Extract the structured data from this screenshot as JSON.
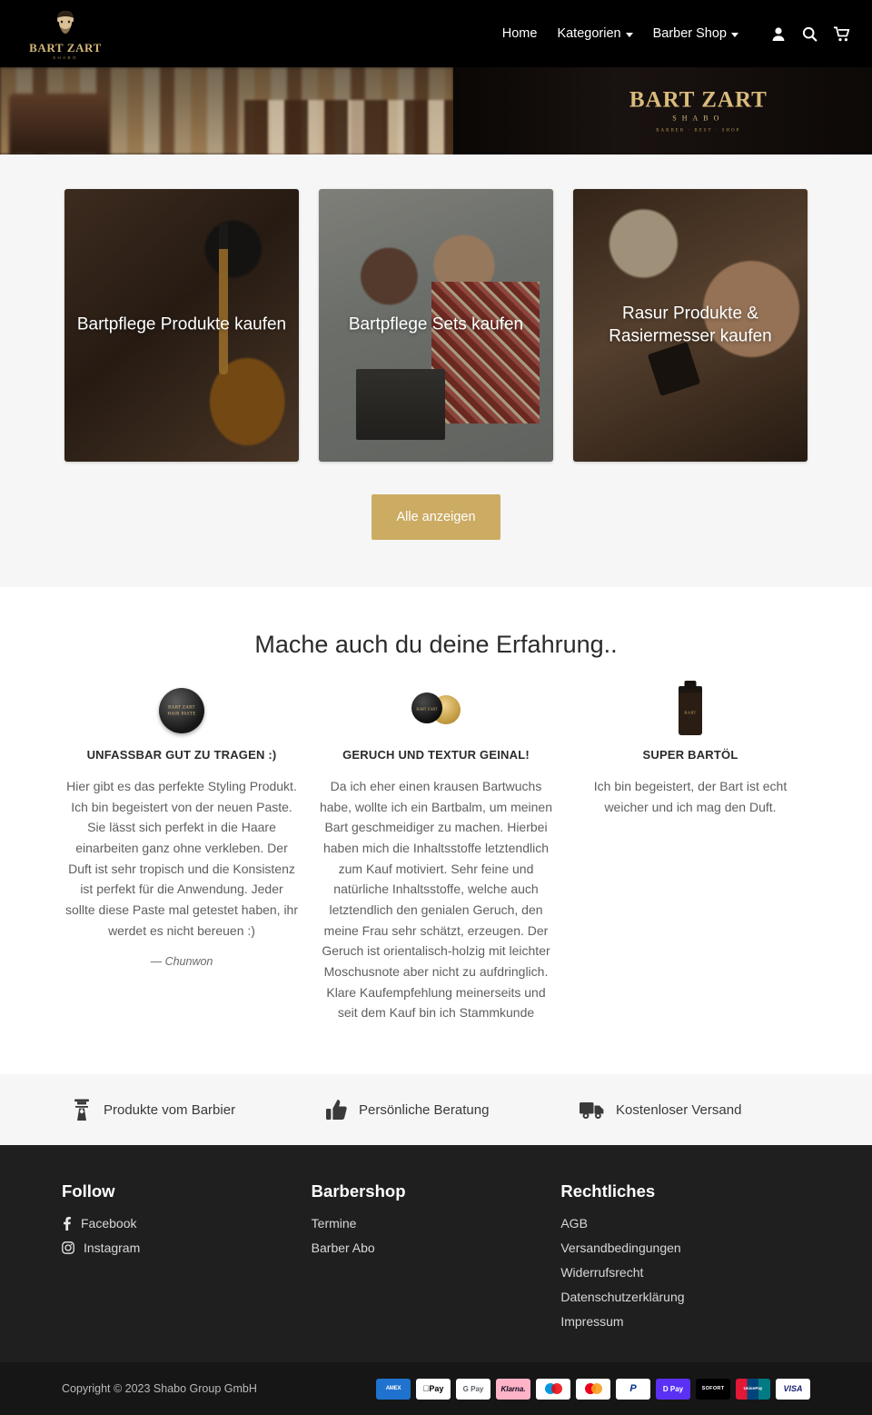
{
  "header": {
    "logo": {
      "word": "BART ZART",
      "sub": "SHABO",
      "icon": "bearded-man-logo"
    },
    "nav": [
      {
        "label": "Home",
        "has_dropdown": false
      },
      {
        "label": "Kategorien",
        "has_dropdown": true
      },
      {
        "label": "Barber Shop",
        "has_dropdown": true
      }
    ],
    "icons": [
      {
        "name": "account-icon",
        "label": "Account"
      },
      {
        "name": "search-icon",
        "label": "Suche"
      },
      {
        "name": "cart-icon",
        "label": "Warenkorb"
      }
    ]
  },
  "hero": {
    "sign_main": "BART ZART",
    "sign_sub": "SHABO",
    "sign_badge": "BARBER  ·  BEST  ·  SHOP",
    "alt": "Barbershop Innenansicht mit Stühlen und Logo-Schild"
  },
  "categories": {
    "cards": [
      {
        "label": "Bartpflege Produkte kaufen",
        "image": "beard-oil-dropper"
      },
      {
        "label": "Bartpflege Sets kaufen",
        "image": "couple-with-gift-set"
      },
      {
        "label": "Rasur Produkte & Rasiermesser kaufen",
        "image": "barber-shaving-client"
      }
    ],
    "cta_label": "Alle anzeigen",
    "cta_color": "#ccab63"
  },
  "testimonials": {
    "title": "Mache auch du deine Erfahrung..",
    "items": [
      {
        "image": "black-hair-paste-tin",
        "heading": "UNFASSBAR GUT ZU TRAGEN :)",
        "body": "Hier gibt es das perfekte Styling Produkt. Ich bin begeistert von der neuen Paste. Sie lässt sich perfekt in die Haare einarbeiten ganz ohne verkleben. Der Duft ist sehr tropisch und die Konsistenz ist perfekt für die Anwendung. Jeder sollte diese Paste mal getestet haben, ihr werdet es nicht bereuen :)",
        "author": "— Chunwon"
      },
      {
        "image": "open-beard-balm-tin",
        "heading": "GERUCH UND TEXTUR GEINAL!",
        "body": "Da ich eher einen krausen Bartwuchs habe, wollte ich ein Bartbalm, um meinen Bart geschmeidiger zu machen. Hierbei haben mich die Inhaltsstoffe letztendlich zum Kauf motiviert. Sehr feine und natürliche Inhaltsstoffe, welche auch letztendlich den genialen Geruch, den meine Frau sehr schätzt, erzeugen. Der Geruch ist orientalisch-holzig mit leichter Moschusnote aber nicht zu aufdringlich. Klare Kaufempfehlung meinerseits und seit dem Kauf bin ich Stammkunde",
        "author": ""
      },
      {
        "image": "beard-oil-bottle",
        "heading": "SUPER BARTÖL",
        "body": "Ich bin begeistert, der Bart ist echt weicher und ich mag den Duft.",
        "author": ""
      }
    ]
  },
  "features": [
    {
      "icon": "barber-icon",
      "label": "Produkte vom Barbier"
    },
    {
      "icon": "thumbs-up-icon",
      "label": "Persönliche Beratung"
    },
    {
      "icon": "delivery-truck-icon",
      "label": "Kostenloser Versand"
    }
  ],
  "footer": {
    "columns": [
      {
        "title": "Follow",
        "links": [
          {
            "label": "Facebook",
            "icon": "facebook-icon"
          },
          {
            "label": "Instagram",
            "icon": "instagram-icon"
          }
        ]
      },
      {
        "title": "Barbershop",
        "links": [
          {
            "label": "Termine",
            "icon": ""
          },
          {
            "label": "Barber Abo",
            "icon": ""
          }
        ]
      },
      {
        "title": "Rechtliches",
        "links": [
          {
            "label": "AGB",
            "icon": ""
          },
          {
            "label": "Versandbedingungen",
            "icon": ""
          },
          {
            "label": "Widerrufsrecht",
            "icon": ""
          },
          {
            "label": "Datenschutzerklärung",
            "icon": ""
          },
          {
            "label": "Impressum",
            "icon": ""
          }
        ]
      }
    ],
    "copyright": "Copyright © 2023 Shabo Group GmbH",
    "payments": [
      {
        "name": "amex",
        "label": "AMEX"
      },
      {
        "name": "apple-pay",
        "label": "Pay"
      },
      {
        "name": "google-pay",
        "label": "G Pay"
      },
      {
        "name": "klarna",
        "label": "Klarna."
      },
      {
        "name": "maestro",
        "label": ""
      },
      {
        "name": "mastercard",
        "label": ""
      },
      {
        "name": "paypal",
        "label": "P"
      },
      {
        "name": "shop-pay",
        "label": "D Pay"
      },
      {
        "name": "sofort",
        "label": "SOFORT"
      },
      {
        "name": "unionpay",
        "label": "UnionPay"
      },
      {
        "name": "visa",
        "label": "VISA"
      }
    ]
  }
}
